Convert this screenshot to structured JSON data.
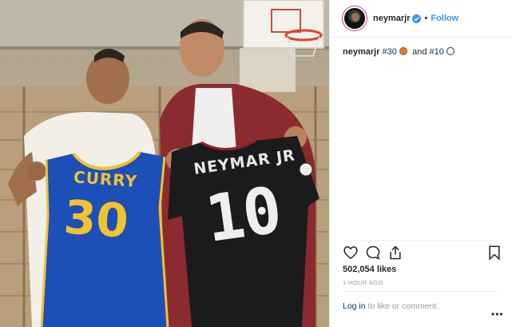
{
  "header": {
    "username": "neymarjr",
    "separator": "•",
    "follow_label": "Follow"
  },
  "caption": {
    "username": "neymarjr",
    "tag1": "#30",
    "conjunction": "and",
    "tag2": "#10"
  },
  "photo": {
    "jersey_left_name": "CURRY",
    "jersey_left_number": "30",
    "jersey_right_name": "NEYMAR JR",
    "jersey_right_number": "10"
  },
  "actions": {
    "icons": [
      "heart-icon",
      "comment-icon",
      "share-icon",
      "bookmark-icon"
    ]
  },
  "stats": {
    "likes": "502,054 likes",
    "timestamp": "1 HOUR AGO"
  },
  "footer": {
    "login_link": "Log in",
    "login_suffix": " to like or comment.",
    "more_label": "•••"
  },
  "colors": {
    "link_blue": "#3897f0",
    "hashtag": "#003569",
    "muted": "#999999",
    "warriors_blue": "#1d4fb8",
    "warriors_gold": "#f1c232",
    "psg_black": "#1b1b1d"
  }
}
